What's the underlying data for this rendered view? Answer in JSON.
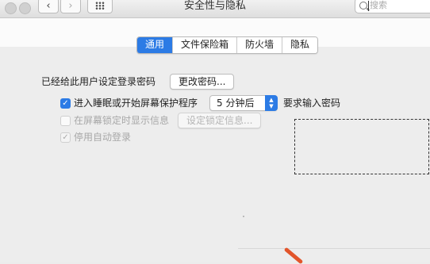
{
  "window": {
    "title": "安全性与隐私"
  },
  "toolbar": {
    "search_placeholder": "搜索"
  },
  "tabs": [
    {
      "label": "通用",
      "active": true
    },
    {
      "label": "文件保险箱",
      "active": false
    },
    {
      "label": "防火墙",
      "active": false
    },
    {
      "label": "隐私",
      "active": false
    }
  ],
  "general": {
    "password_label": "已经给此用户设定登录密码",
    "change_password_button": "更改密码...",
    "require_password": {
      "checked": true,
      "label": "进入睡眠或开始屏幕保护程序",
      "delay_value": "5 分钟后",
      "suffix": "要求输入密码"
    },
    "show_message": {
      "checked": false,
      "enabled": false,
      "label": "在屏幕锁定时显示信息",
      "button": "设定锁定信息..."
    },
    "disable_auto_login": {
      "checked": true,
      "enabled": false,
      "label": "停用自动登录"
    }
  },
  "colors": {
    "accent": "#2c7be5",
    "annotation_arrow": "#e2552b"
  }
}
